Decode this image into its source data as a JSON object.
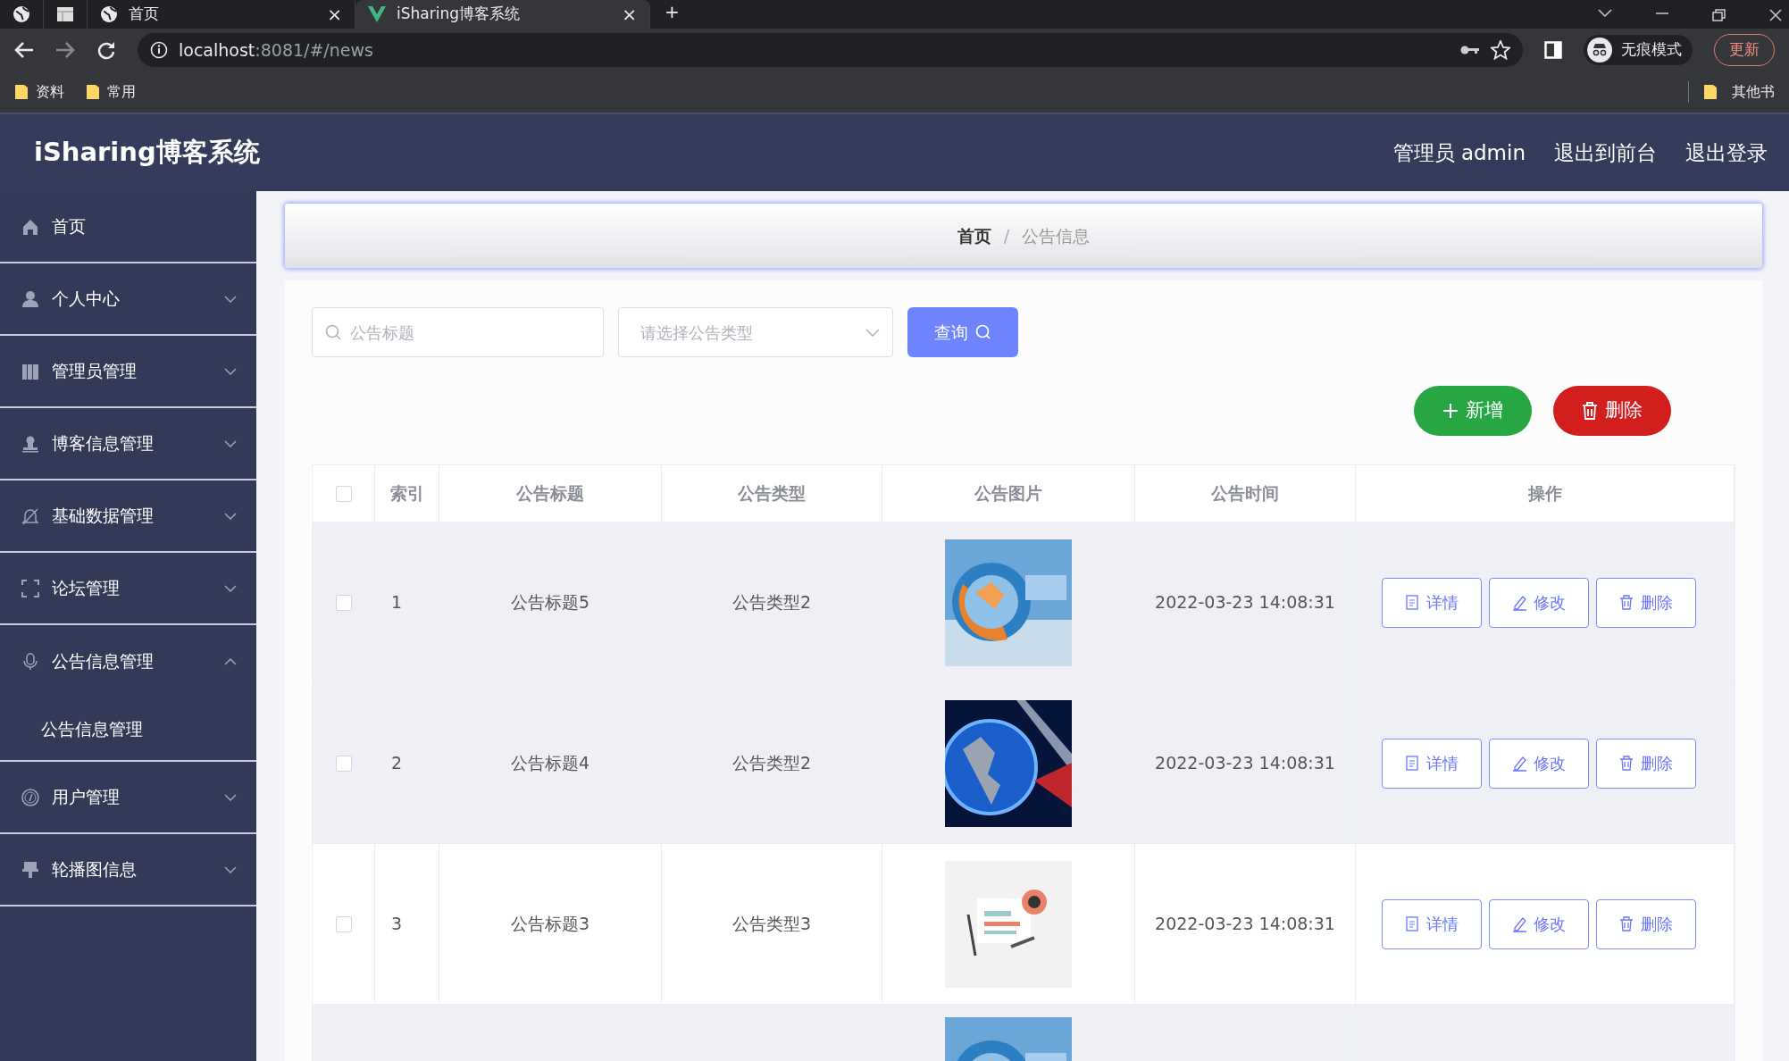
{
  "browser": {
    "tabs": [
      {
        "kind": "pinned",
        "selected": false
      },
      {
        "kind": "pinned",
        "selected": false
      },
      {
        "kind": "page",
        "title": "首页",
        "close": "×",
        "selected": false
      },
      {
        "kind": "page",
        "title": "iSharing博客系统",
        "close": "×",
        "selected": true
      }
    ],
    "new_tab": "+",
    "address": {
      "host": "localhost",
      "path": ":8081/#/news"
    },
    "incognito": "无痕模式",
    "update_button": "更新",
    "bookmarks": [
      "资料",
      "常用"
    ],
    "other_bookmarks": "其他书"
  },
  "app": {
    "title": "iSharing博客系统",
    "header_links": [
      "管理员 admin",
      "退出到前台",
      "退出登录"
    ]
  },
  "sidebar": {
    "items": [
      {
        "kind": "link",
        "label": "首页"
      },
      {
        "kind": "menu",
        "label": "个人中心",
        "expanded": false
      },
      {
        "kind": "menu",
        "label": "管理员管理",
        "expanded": false
      },
      {
        "kind": "menu",
        "label": "博客信息管理",
        "expanded": false
      },
      {
        "kind": "menu",
        "label": "基础数据管理",
        "expanded": false
      },
      {
        "kind": "menu",
        "label": "论坛管理",
        "expanded": false
      },
      {
        "kind": "menu",
        "label": "公告信息管理",
        "expanded": true,
        "children": [
          {
            "label": "公告信息管理"
          }
        ]
      },
      {
        "kind": "menu",
        "label": "用户管理",
        "expanded": false
      },
      {
        "kind": "menu",
        "label": "轮播图信息",
        "expanded": false
      }
    ]
  },
  "breadcrumb": [
    "首页",
    "/",
    "公告信息"
  ],
  "filters": {
    "title": {
      "placeholder": "公告标题"
    },
    "type": {
      "placeholder": "请选择公告类型"
    },
    "query_button": "查询"
  },
  "actions": {
    "add": "新增",
    "delete": "删除"
  },
  "table": {
    "header_checked": false,
    "columns": [
      "索引",
      "公告标题",
      "公告类型",
      "公告图片",
      "公告时间",
      "操作"
    ],
    "rows": [
      {
        "shaded": true,
        "checked": false,
        "index": "1",
        "title": "公告标题5",
        "type": "公告类型2",
        "image": {
          "kind": "picture"
        },
        "time": "2022-03-23 14:08:31",
        "buttons": [
          "详情",
          "修改",
          "删除"
        ]
      },
      {
        "shaded": true,
        "checked": false,
        "index": "2",
        "title": "公告标题4",
        "type": "公告类型2",
        "image": {
          "kind": "picture"
        },
        "time": "2022-03-23 14:08:31",
        "buttons": [
          "详情",
          "修改",
          "删除"
        ]
      },
      {
        "shaded": false,
        "checked": false,
        "index": "3",
        "title": "公告标题3",
        "type": "公告类型3",
        "image": {
          "kind": "picture"
        },
        "time": "2022-03-23 14:08:31",
        "buttons": [
          "详情",
          "修改",
          "删除"
        ]
      },
      {
        "shaded": true,
        "image": {
          "kind": "picture"
        }
      }
    ]
  }
}
